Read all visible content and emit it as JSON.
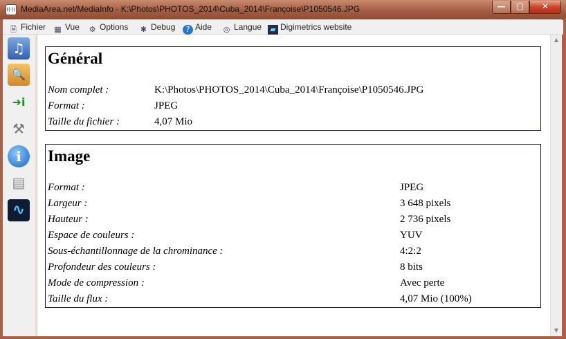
{
  "window": {
    "title": "MediaArea.net/MediaInfo - K:\\Photos\\PHOTOS_2014\\Cuba_2014\\Françoise\\P1050546.JPG",
    "app_icon_glyph": "((·))"
  },
  "title_buttons": {
    "minimize": "—",
    "maximize": "▢",
    "close": "✕"
  },
  "menu": {
    "items": [
      {
        "label": "Fichier",
        "icon": "file-icon",
        "glyph": "🗎"
      },
      {
        "label": "Vue",
        "icon": "view-icon",
        "glyph": "▦"
      },
      {
        "label": "Options",
        "icon": "options-icon",
        "glyph": "⚙"
      },
      {
        "label": "Debug",
        "icon": "debug-icon",
        "glyph": "✱"
      },
      {
        "label": "Aide",
        "icon": "help-icon",
        "glyph": "?"
      },
      {
        "label": "Langue",
        "icon": "language-icon",
        "glyph": "◎"
      },
      {
        "label": "Digimetrics website",
        "icon": "digimetrics-icon",
        "glyph": "▰"
      }
    ]
  },
  "sidebar": {
    "icons": [
      {
        "name": "open-file-icon",
        "glyph": "♫"
      },
      {
        "name": "open-folder-icon",
        "glyph": "🔍"
      },
      {
        "name": "export-icon",
        "glyph": "➜i"
      },
      {
        "name": "preferences-icon",
        "glyph": "⚒"
      },
      {
        "name": "about-icon",
        "glyph": "i"
      },
      {
        "name": "reports-icon",
        "glyph": "▤"
      },
      {
        "name": "digimetrics-logo-icon",
        "glyph": "∿"
      }
    ]
  },
  "colors": {
    "titlebar": "#a55e43",
    "section_border": "#1a1a40",
    "content_bg": "#ffffff"
  },
  "sections": {
    "general": {
      "title": "Général",
      "rows": [
        {
          "key": "Nom complet :",
          "value": "K:\\Photos\\PHOTOS_2014\\Cuba_2014\\Françoise\\P1050546.JPG"
        },
        {
          "key": "Format :",
          "value": "JPEG"
        },
        {
          "key": "Taille du fichier :",
          "value": "4,07 Mio"
        }
      ]
    },
    "image": {
      "title": "Image",
      "rows": [
        {
          "key": "Format :",
          "value": "JPEG"
        },
        {
          "key": "Largeur :",
          "value": "3 648 pixels"
        },
        {
          "key": "Hauteur :",
          "value": "2 736 pixels"
        },
        {
          "key": "Espace de couleurs :",
          "value": "YUV"
        },
        {
          "key": "Sous-échantillonnage de la chrominance :",
          "value": "4:2:2"
        },
        {
          "key": "Profondeur des couleurs :",
          "value": "8 bits"
        },
        {
          "key": "Mode de compression :",
          "value": "Avec perte"
        },
        {
          "key": "Taille du flux :",
          "value": "4,07 Mio (100%)"
        }
      ]
    }
  },
  "scrollbar": {
    "up_arrow": "▲",
    "down_arrow": "▼"
  }
}
